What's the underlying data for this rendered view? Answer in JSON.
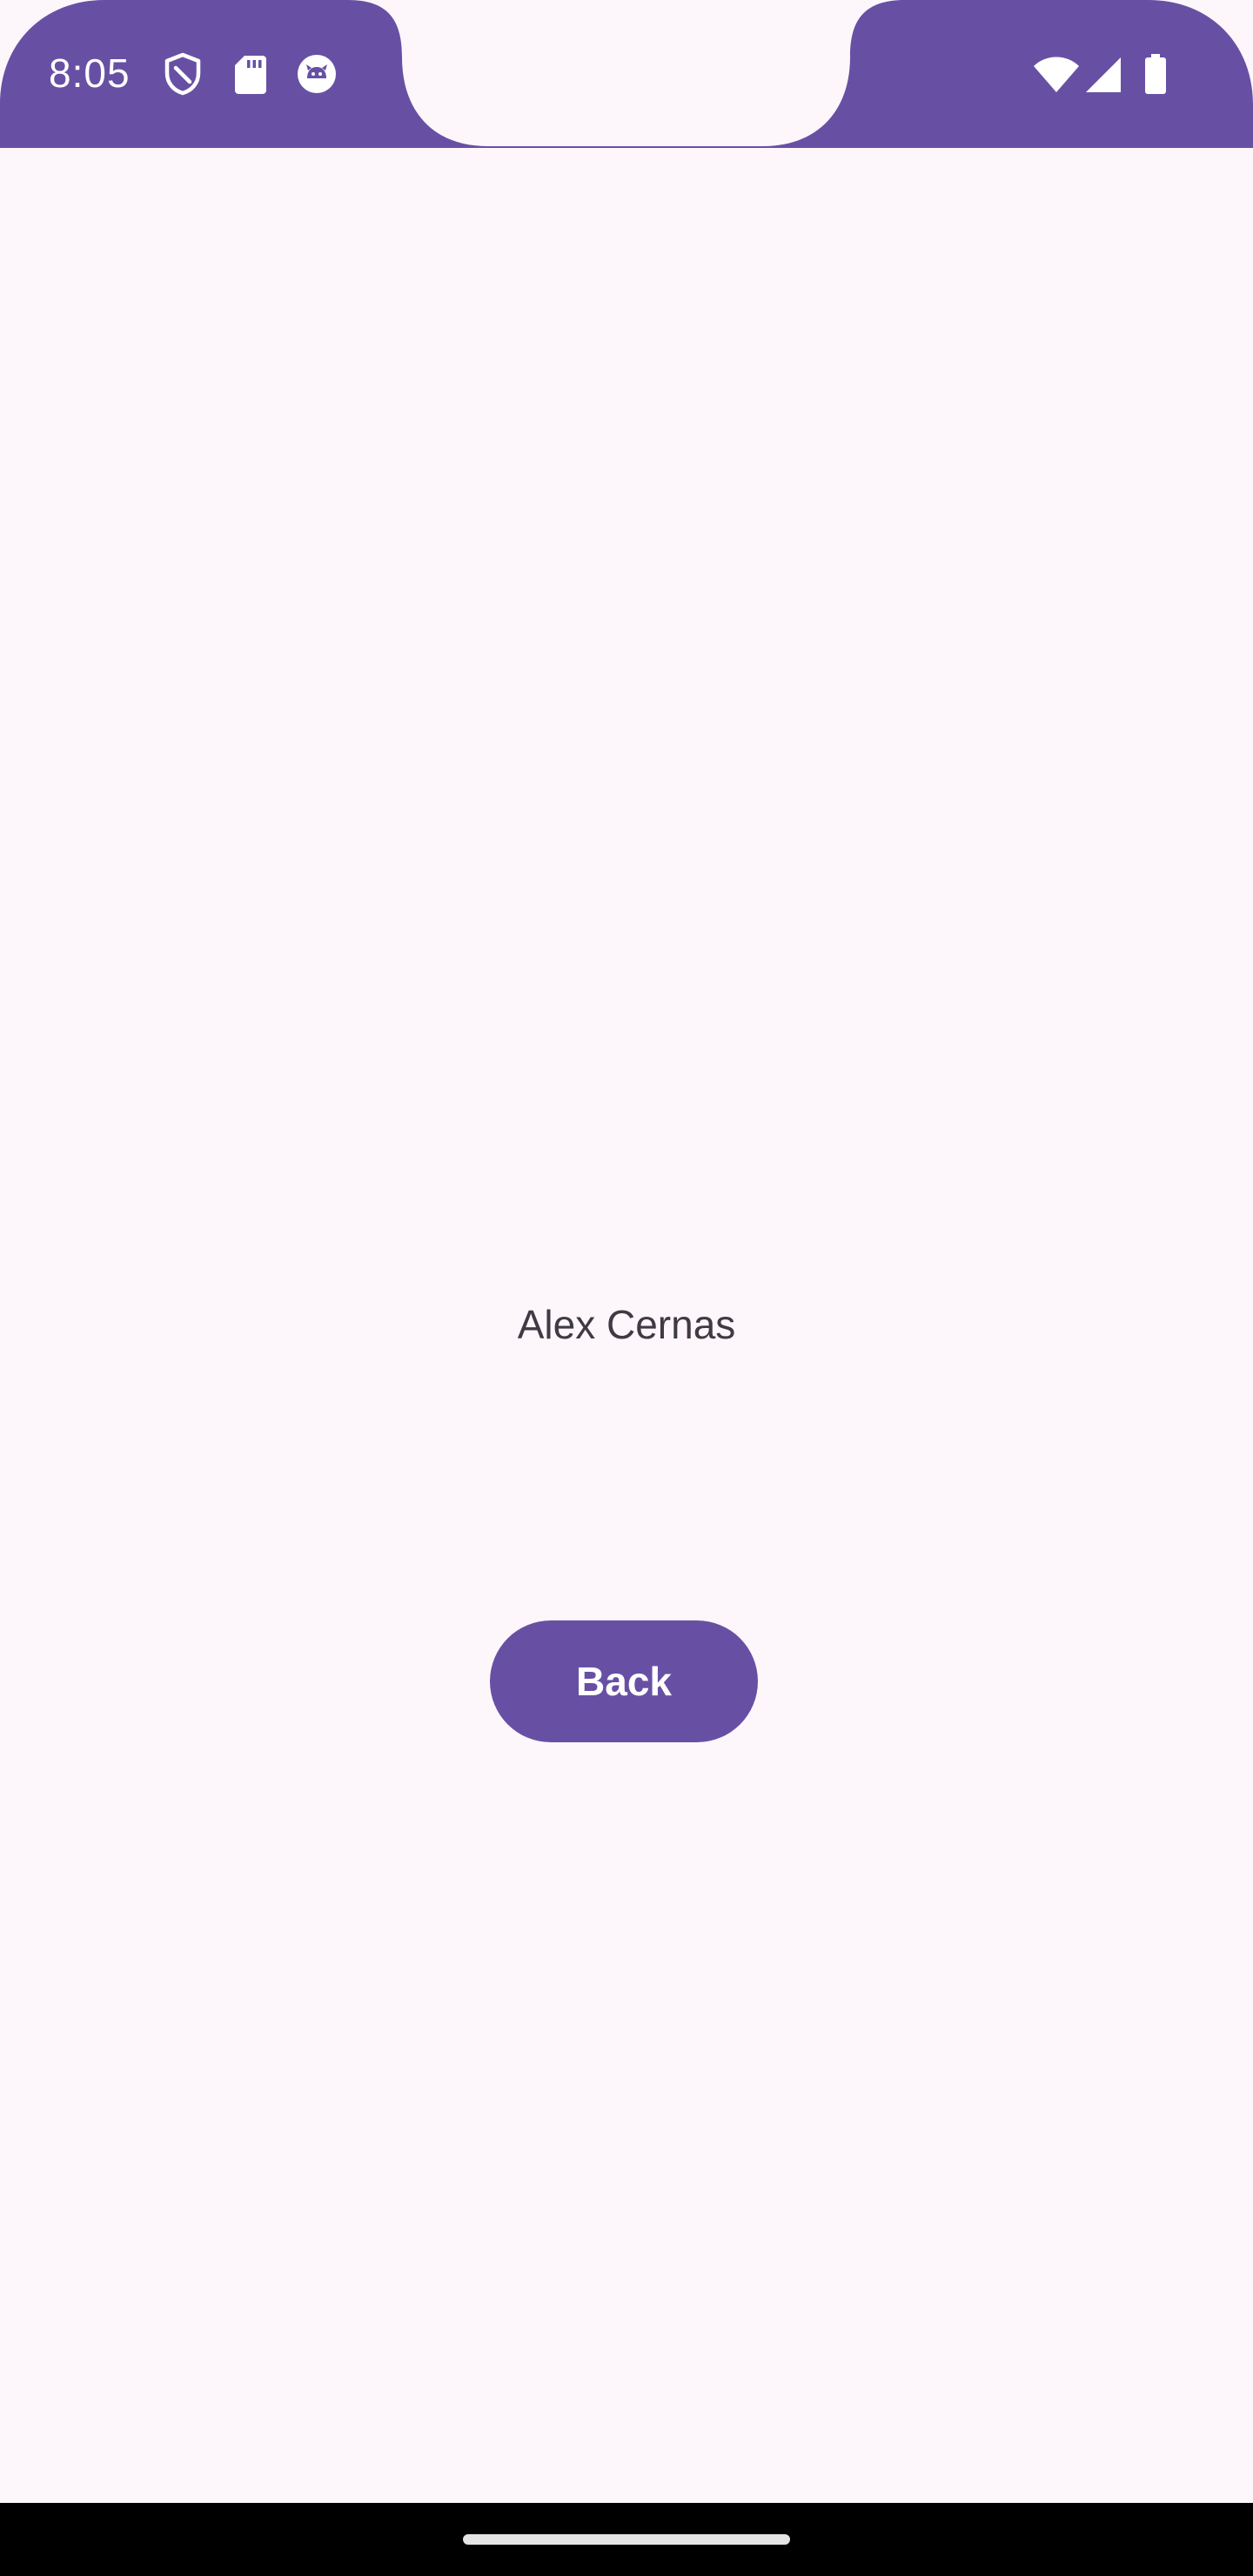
{
  "status_bar": {
    "time": "8:05",
    "background_color": "#6750A4",
    "left_icons": [
      "shield-icon",
      "sd-card-icon",
      "android-debug-icon"
    ],
    "right_icons": [
      "wifi-icon",
      "cell-signal-icon",
      "battery-icon"
    ]
  },
  "main": {
    "name": "Alex Cernas",
    "back_button_label": "Back",
    "background_color": "#FDF7FC",
    "accent_color": "#6750A4"
  },
  "nav_bar": {
    "icon": "home-handle"
  }
}
